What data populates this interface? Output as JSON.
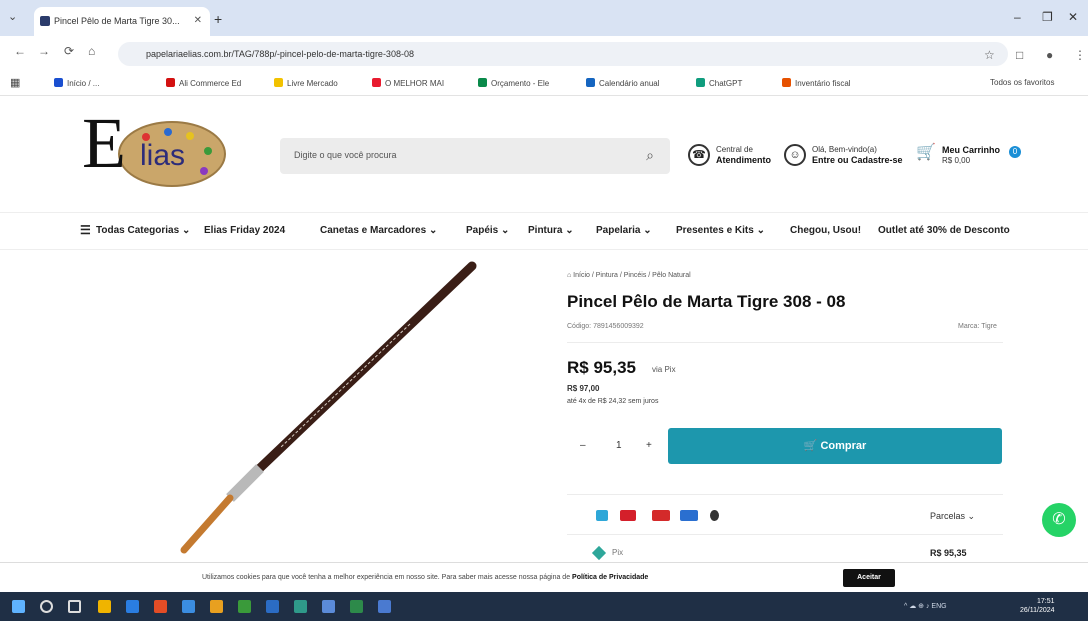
{
  "browser": {
    "tab_title": "Pincel Pêlo de Marta Tigre 30...",
    "new_tab": "+",
    "tab_close": "✕",
    "tab_menu": "⌄",
    "win_min": "–",
    "win_max": "❐",
    "win_close": "✕",
    "back": "←",
    "forward": "→",
    "reload": "⟳",
    "home": "⌂",
    "url": "papelariaelias.com.br/TAG/788p/-pincel-pelo-de-marta-tigre-308-08",
    "star": "☆",
    "extensions": "□",
    "profile": "●",
    "menu": "⋮",
    "bookmarks": [
      {
        "label": "Início / ...",
        "color": "#1a4fd0"
      },
      {
        "label": "Ali Commerce Ed",
        "color": "#d31111"
      },
      {
        "label": "Livre Mercado",
        "color": "#f2c200"
      },
      {
        "label": "O MELHOR MAI",
        "color": "#e81b2f"
      },
      {
        "label": "Orçamento - Ele",
        "color": "#0a8a4a"
      },
      {
        "label": "Calendário anual",
        "color": "#1565c0"
      },
      {
        "label": "ChatGPT",
        "color": "#109d7e"
      },
      {
        "label": "Inventário fiscal",
        "color": "#e65100"
      }
    ],
    "all_bookmarks": "Todos os favoritos"
  },
  "header": {
    "logo_letter": "E",
    "logo_text": "lias",
    "search_placeholder": "Digite o que você procura",
    "search_icon": "⌕",
    "service": {
      "line1": "Central de",
      "line2": "Atendimento"
    },
    "account": {
      "line1": "Olá, Bem-vindo(a)",
      "line2": "Entre ou Cadastre-se"
    },
    "cart": {
      "line1": "Meu Carrinho",
      "line2": "R$ 0,00",
      "count": "0"
    }
  },
  "nav": {
    "items": [
      "Todas Categorias ⌄",
      "Elias Friday 2024",
      "Canetas e Marcadores ⌄",
      "Papéis ⌄",
      "Pintura ⌄",
      "Papelaria ⌄",
      "Presentes e Kits ⌄",
      "Chegou, Usou!",
      "Outlet até 30% de Desconto"
    ]
  },
  "product": {
    "breadcrumb": "⌂ Início / Pintura / Pincéis / Pêlo Natural",
    "title": "Pincel Pêlo de Marta Tigre 308 - 08",
    "code": "Código: 7891456009392",
    "brand": "Marca: Tigre",
    "price": "R$ 95,35",
    "price_unit": "via Pix",
    "price_card": "R$ 97,00",
    "installments_text": "até 4x de R$ 24,32 sem juros",
    "qty_minus": "–",
    "qty_value": "1",
    "qty_plus": "+",
    "buy_label": "🛒 Comprar",
    "parcelas_label": "Parcelas ⌄",
    "pix_label": "Pix",
    "pix_value": "R$ 95,35",
    "whatsapp_icon": "✆"
  },
  "cookie": {
    "text": "Utilizamos cookies para que você tenha a melhor experiência em nosso site. Para saber mais acesse nossa página de ",
    "link": "Política de Privacidade",
    "accept": "Aceitar"
  },
  "taskbar": {
    "tray": "^  ☁  ⊕  ♪  ENG",
    "time": "17:51",
    "date": "26/11/2024"
  },
  "colors": {
    "accent": "#1d97ad",
    "whatsapp": "#25d366",
    "tabbar": "#d9e3f3",
    "taskbar": "#1f2f45"
  }
}
